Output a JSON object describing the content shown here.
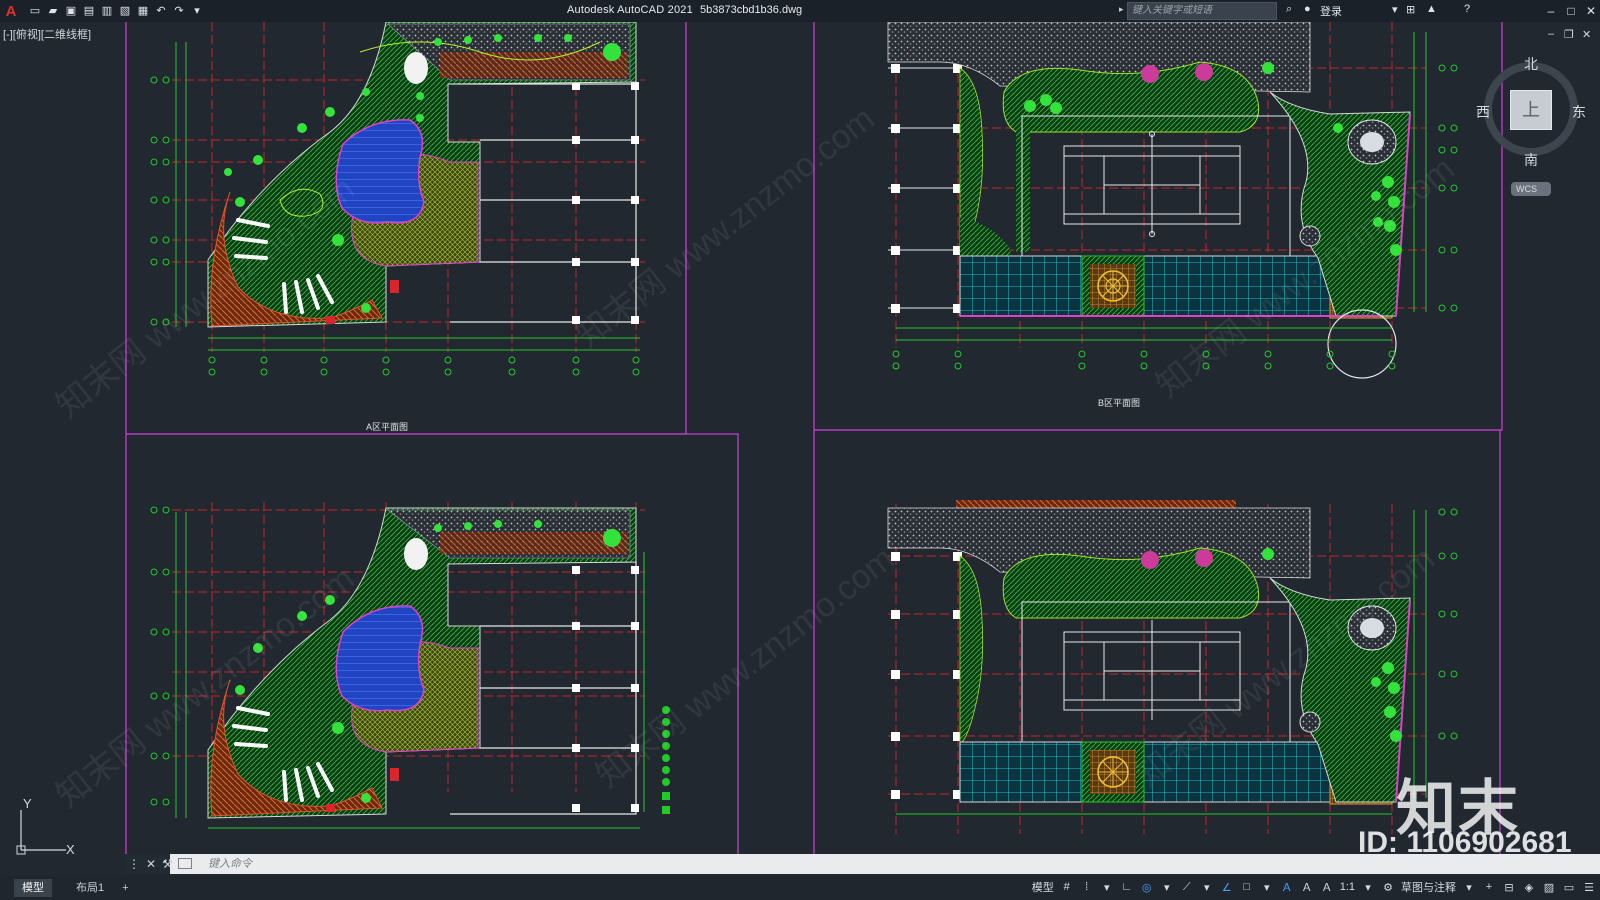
{
  "titlebar": {
    "app_title": "Autodesk AutoCAD 2021",
    "file_name": "5b3873cbd1b36.dwg",
    "search_placeholder": "键入关键字或短语",
    "login_label": "登录"
  },
  "viewport": {
    "label": "[-][俯视][二维线框]"
  },
  "drawing": {
    "sheet_a_title": "A区平面图",
    "sheet_b_title": "B区平面图"
  },
  "viewcube": {
    "north": "北",
    "south": "南",
    "east": "东",
    "west": "西",
    "face": "上",
    "wcs": "WCS"
  },
  "ucs": {
    "x": "X",
    "y": "Y"
  },
  "command": {
    "placeholder": "键入命令"
  },
  "status": {
    "tab_model": "模型",
    "tab_layout1": "布局1",
    "tab_add": "+",
    "model_label": "模型",
    "scale": "1:1",
    "workspace": "草图与注释"
  },
  "watermark": {
    "brand": "知末",
    "id": "ID: 1106902681",
    "diag": "知末网 www.znzmo.com"
  },
  "colors": {
    "background": "#212830",
    "grid_red": "#d8262a",
    "border_magenta": "#c040c8",
    "plant_green": "#22c928",
    "pool_blue": "#2a4fd0",
    "tile_cyan": "#1aa8b8",
    "paving_orange": "#e0542a"
  }
}
